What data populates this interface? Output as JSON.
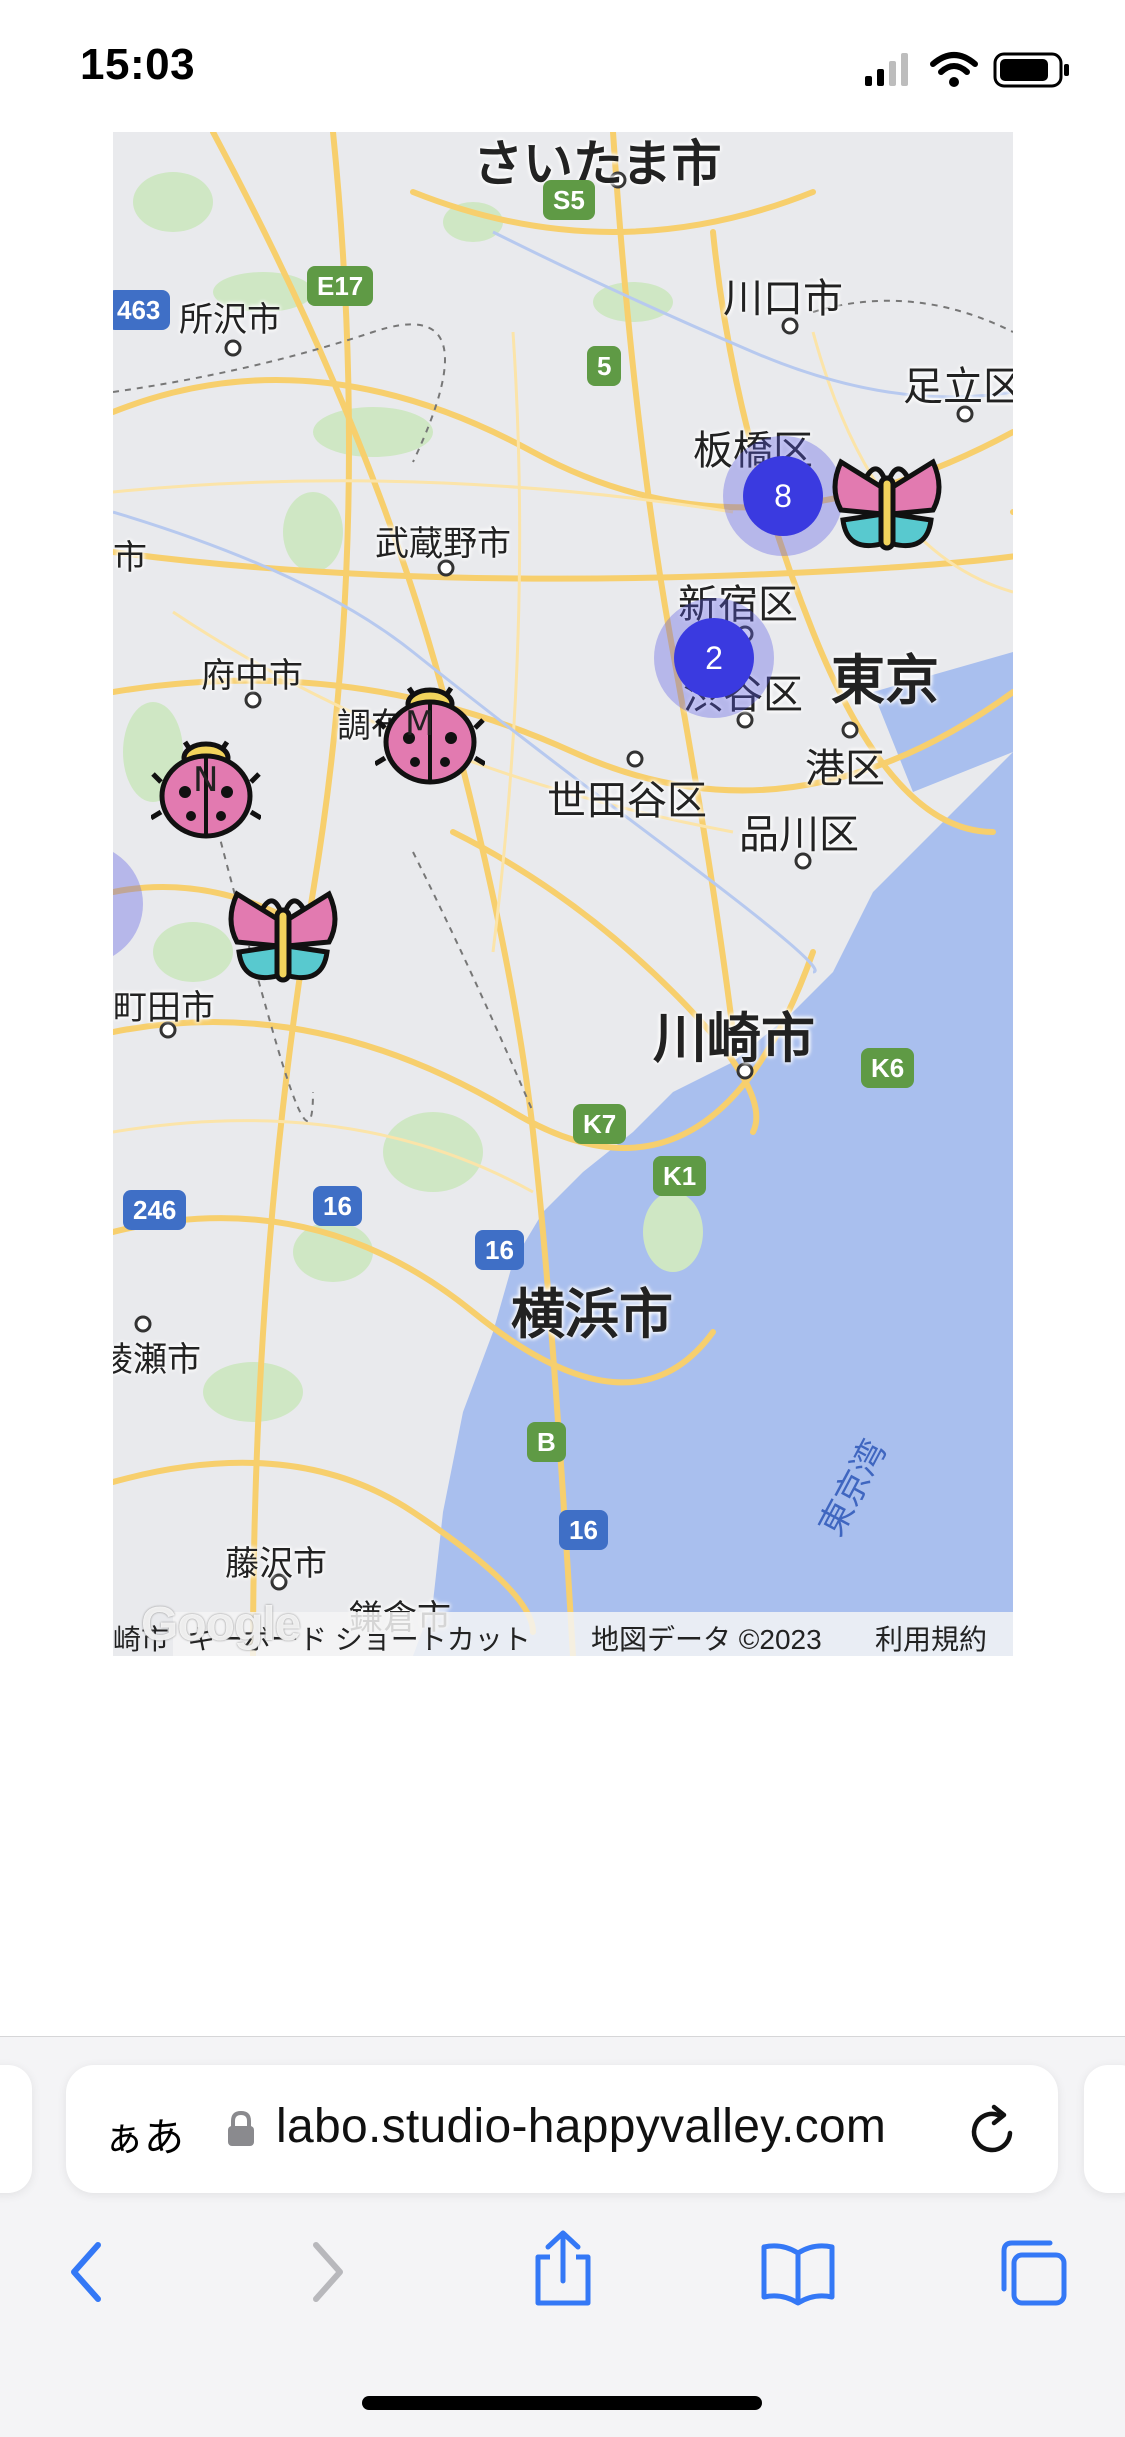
{
  "status_bar": {
    "time": "15:03"
  },
  "map": {
    "places": [
      {
        "key": "saitama",
        "text": "さいたま市"
      },
      {
        "key": "tokorozawa",
        "text": "所沢市"
      },
      {
        "key": "kawaguchi",
        "text": "川口市"
      },
      {
        "key": "adachi",
        "text": "足立区"
      },
      {
        "key": "itabashi",
        "text": "板橋区"
      },
      {
        "key": "musashino",
        "text": "武蔵野市"
      },
      {
        "key": "shi_left",
        "text": "市"
      },
      {
        "key": "shinjuku",
        "text": "新宿区"
      },
      {
        "key": "fuchu",
        "text": "府中市"
      },
      {
        "key": "shibuya",
        "text": "渋谷区"
      },
      {
        "key": "tokyo",
        "text": "東京"
      },
      {
        "key": "chofu",
        "text": "調布"
      },
      {
        "key": "minato",
        "text": "港区"
      },
      {
        "key": "setagaya",
        "text": "世田谷区"
      },
      {
        "key": "shinagawa",
        "text": "品川区"
      },
      {
        "key": "machida",
        "text": "町田市"
      },
      {
        "key": "kawasaki",
        "text": "川崎市"
      },
      {
        "key": "yokohama",
        "text": "横浜市"
      },
      {
        "key": "ayase",
        "text": "綾瀬市"
      },
      {
        "key": "fujisawa",
        "text": "藤沢市"
      },
      {
        "key": "kamakura",
        "text": "鎌倉市"
      },
      {
        "key": "tokyowan",
        "text": "東京湾"
      }
    ],
    "shields": [
      {
        "key": "s5",
        "text": "S5",
        "color": "green"
      },
      {
        "key": "e17",
        "text": "E17",
        "color": "green"
      },
      {
        "key": "r463",
        "text": "463",
        "color": "blue"
      },
      {
        "key": "r5",
        "text": "5",
        "color": "green"
      },
      {
        "key": "k7",
        "text": "K7",
        "color": "green"
      },
      {
        "key": "k1",
        "text": "K1",
        "color": "green"
      },
      {
        "key": "k6",
        "text": "K6",
        "color": "green"
      },
      {
        "key": "r246",
        "text": "246",
        "color": "blue"
      },
      {
        "key": "r16a",
        "text": "16",
        "color": "blue"
      },
      {
        "key": "r16b",
        "text": "16",
        "color": "blue"
      },
      {
        "key": "rb",
        "text": "B",
        "color": "green"
      },
      {
        "key": "r16c",
        "text": "16",
        "color": "blue"
      }
    ],
    "clusters": [
      {
        "key": "itabashi_cluster",
        "count": "8"
      },
      {
        "key": "shibuya_cluster",
        "count": "2"
      }
    ],
    "markers": [
      {
        "key": "butterfly_tokyo",
        "icon": "butterfly-icon"
      },
      {
        "key": "ladybug_chofu",
        "icon": "ladybug-icon",
        "letter": "M"
      },
      {
        "key": "ladybug_west",
        "icon": "ladybug-icon",
        "letter": "N"
      },
      {
        "key": "butterfly_machida",
        "icon": "butterfly-icon"
      }
    ],
    "footer": {
      "google": "Google",
      "shortcuts": "キーボード ショートカット",
      "map_data": "地図データ ©2023",
      "terms": "利用規約",
      "left_partial": "崎市"
    }
  },
  "browser": {
    "aa_label": "ぁあ",
    "url": "labo.studio-happyvalley.com",
    "nav": [
      "back",
      "forward",
      "share",
      "bookmarks",
      "tabs"
    ]
  },
  "colors": {
    "accent": "#3478f6",
    "cluster": "#3a3ae0",
    "water": "#a9bfee",
    "road": "#f7cf6d"
  }
}
